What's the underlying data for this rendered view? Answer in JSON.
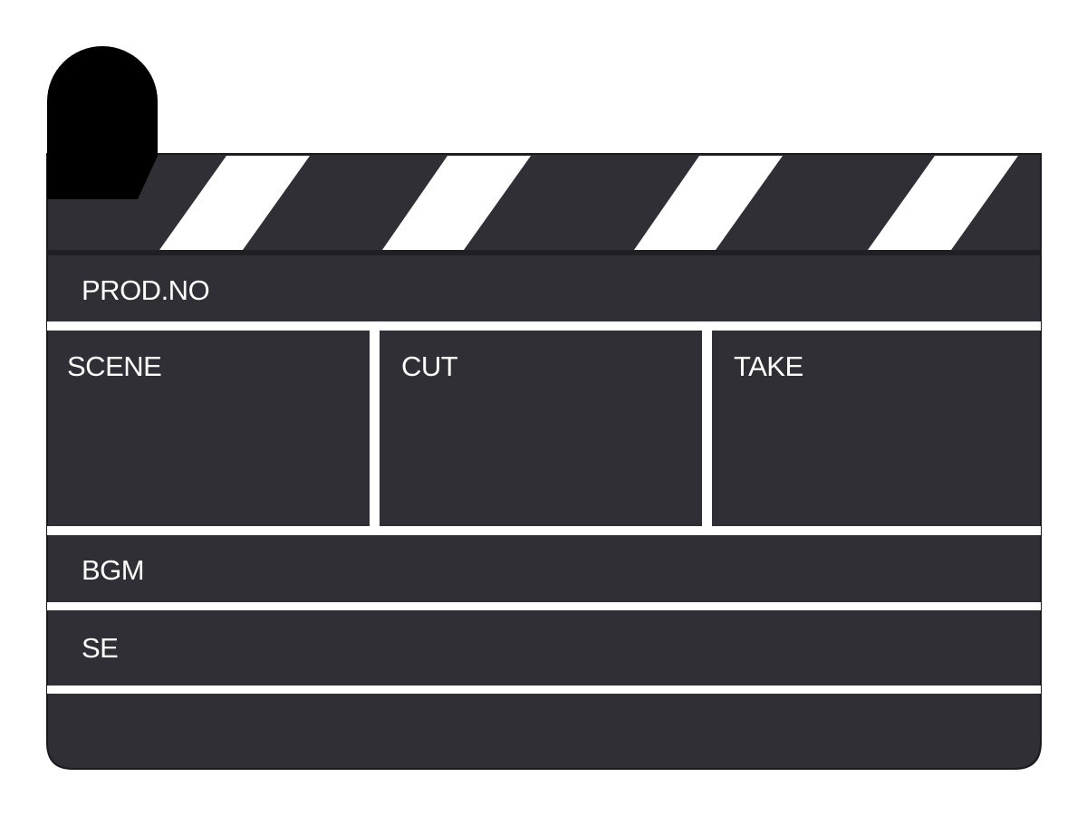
{
  "clapperboard": {
    "prod_no_label": "PROD.NO",
    "scene_label": "SCENE",
    "cut_label": "CUT",
    "take_label": "TAKE",
    "bgm_label": "BGM",
    "se_label": "SE"
  },
  "colors": {
    "board": "#2f2f35",
    "outline": "#1a1a1e",
    "hinge": "#000000",
    "stripe": "#ffffff",
    "divider": "#ffffff",
    "text": "#ffffff"
  }
}
